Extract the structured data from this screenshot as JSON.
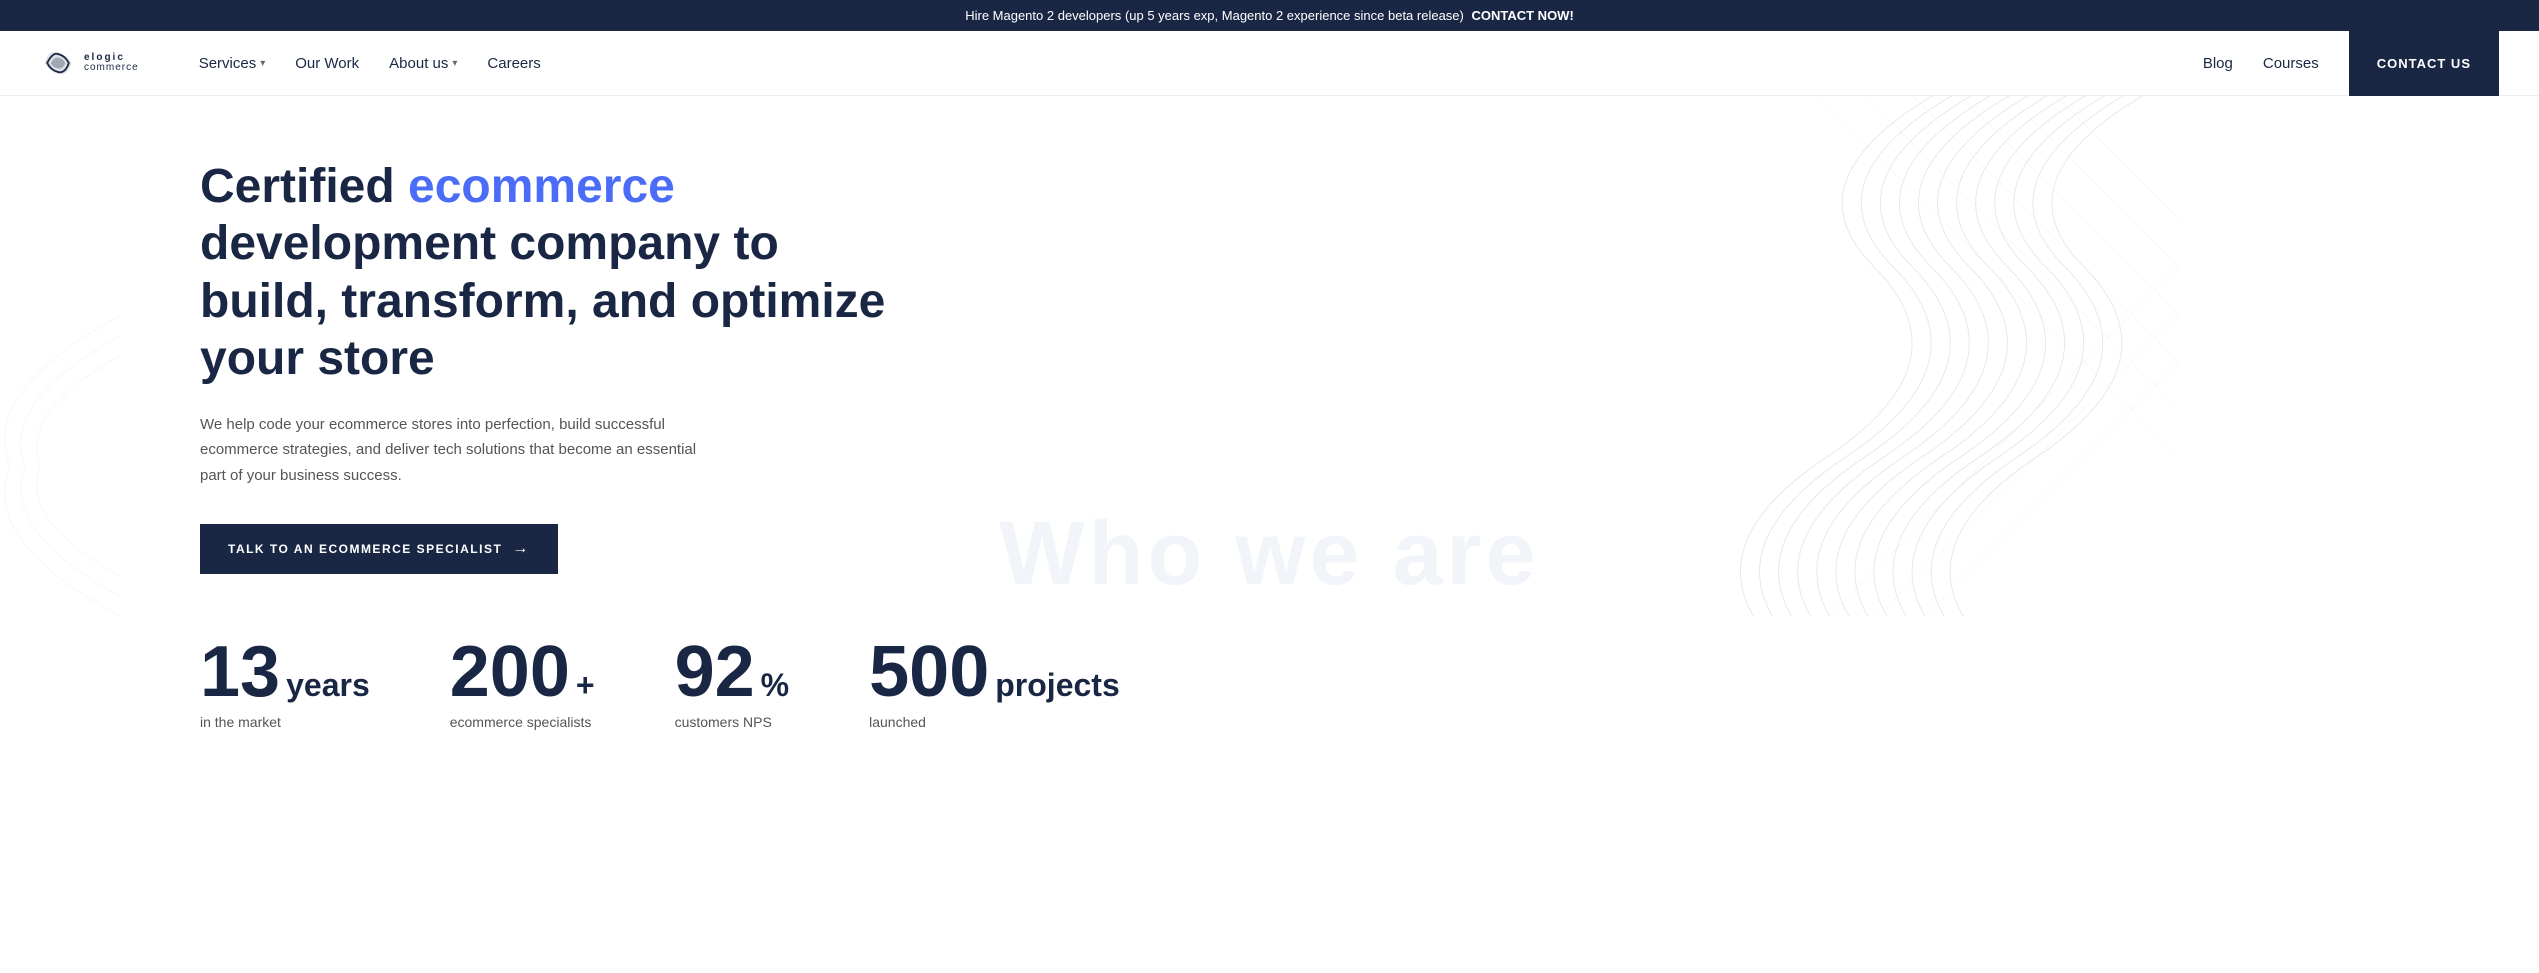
{
  "banner": {
    "text_before": "Hire Magento 2 developers",
    "text_paren": "(up 5 years exp, Magento 2 experience since beta release)",
    "cta": "CONTACT NOW!"
  },
  "navbar": {
    "logo_top": "elogic",
    "logo_bottom": "commerce",
    "nav_items": [
      {
        "label": "Services",
        "has_dropdown": true
      },
      {
        "label": "Our Work",
        "has_dropdown": false
      },
      {
        "label": "About us",
        "has_dropdown": true
      },
      {
        "label": "Careers",
        "has_dropdown": false
      }
    ],
    "right_items": [
      {
        "label": "Blog"
      },
      {
        "label": "Courses"
      }
    ],
    "contact_label": "CONTACT US"
  },
  "hero": {
    "title_before": "Certified ",
    "title_accent": "ecommerce",
    "title_after": " development company to build, transform, and optimize your store",
    "description": "We help code your ecommerce stores into perfection, build successful ecommerce strategies, and deliver tech solutions that become an essential part of your business success.",
    "cta_label": "TALK TO AN ECOMMERCE SPECIALIST",
    "who_bg": "Who we are"
  },
  "stats": [
    {
      "number": "13",
      "unit": "years",
      "label": "in the market"
    },
    {
      "number": "200",
      "unit": "+",
      "label": "ecommerce specialists"
    },
    {
      "number": "92",
      "unit": "%",
      "label": "customers NPS"
    },
    {
      "number": "500",
      "unit": "projects",
      "label": "launched"
    }
  ]
}
